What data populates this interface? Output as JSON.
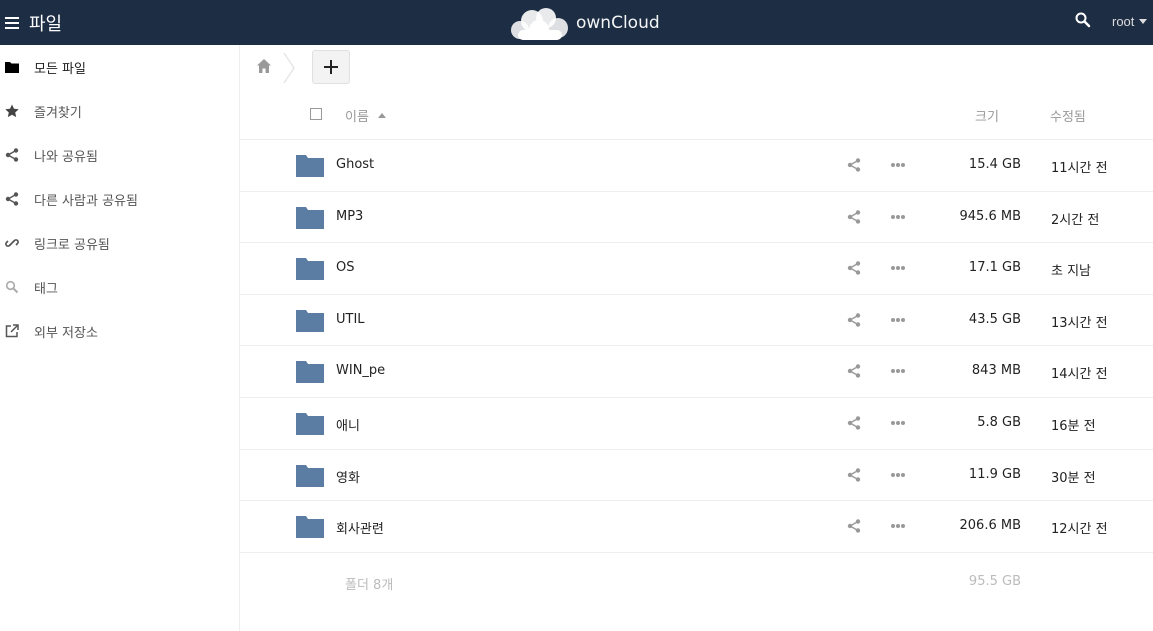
{
  "header": {
    "app_name": "파일",
    "logo_text": "ownCloud",
    "user": "root"
  },
  "sidebar": {
    "items": [
      {
        "label": "모든 파일",
        "icon": "folder-icon"
      },
      {
        "label": "즐겨찾기",
        "icon": "star-icon"
      },
      {
        "label": "나와 공유됨",
        "icon": "share-icon"
      },
      {
        "label": "다른 사람과 공유됨",
        "icon": "share-icon"
      },
      {
        "label": "링크로 공유됨",
        "icon": "link-icon"
      },
      {
        "label": "태그",
        "icon": "tag-search-icon"
      },
      {
        "label": "외부 저장소",
        "icon": "external-link-icon"
      }
    ]
  },
  "table": {
    "headers": {
      "name": "이름",
      "size": "크기",
      "modified": "수정됨"
    },
    "rows": [
      {
        "name": "Ghost",
        "size": "15.4 GB",
        "modified": "11시간 전"
      },
      {
        "name": "MP3",
        "size": "945.6 MB",
        "modified": "2시간 전"
      },
      {
        "name": "OS",
        "size": "17.1 GB",
        "modified": "초 지남"
      },
      {
        "name": "UTIL",
        "size": "43.5 GB",
        "modified": "13시간 전"
      },
      {
        "name": "WIN_pe",
        "size": "843 MB",
        "modified": "14시간 전"
      },
      {
        "name": "애니",
        "size": "5.8 GB",
        "modified": "16분 전"
      },
      {
        "name": "영화",
        "size": "11.9 GB",
        "modified": "30분 전"
      },
      {
        "name": "회사관련",
        "size": "206.6 MB",
        "modified": "12시간 전"
      }
    ],
    "summary": {
      "count": "폴더 8개",
      "total": "95.5 GB"
    }
  },
  "colors": {
    "header_bg": "#1d2d44",
    "folder": "#5b7ca3"
  }
}
